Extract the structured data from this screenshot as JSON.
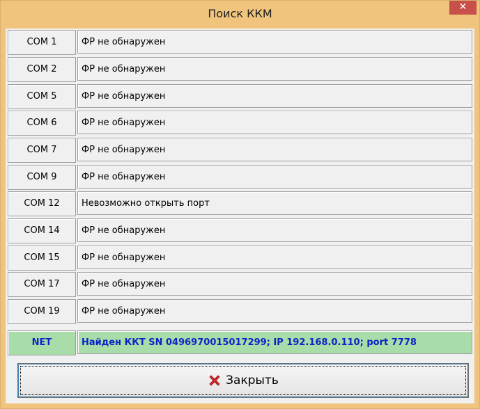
{
  "window": {
    "title": "Поиск ККМ",
    "close_glyph": "✕"
  },
  "rows": [
    {
      "port": "COM 1",
      "status": "ФР не обнаружен"
    },
    {
      "port": "COM 2",
      "status": "ФР не обнаружен"
    },
    {
      "port": "COM 5",
      "status": "ФР не обнаружен"
    },
    {
      "port": "COM 6",
      "status": "ФР не обнаружен"
    },
    {
      "port": "COM 7",
      "status": "ФР не обнаружен"
    },
    {
      "port": "COM 9",
      "status": "ФР не обнаружен"
    },
    {
      "port": "COM 12",
      "status": "Невозможно открыть порт"
    },
    {
      "port": "COM 14",
      "status": "ФР не обнаружен"
    },
    {
      "port": "COM 15",
      "status": "ФР не обнаружен"
    },
    {
      "port": "COM 17",
      "status": "ФР не обнаружен"
    },
    {
      "port": "COM 19",
      "status": "ФР не обнаружен"
    },
    {
      "port": "NET",
      "status": "Найден ККТ SN 0496970015017299; IP 192.168.0.110; port 7778"
    }
  ],
  "close_button": {
    "label": "Закрыть",
    "icon": "red-x-icon"
  },
  "colors": {
    "titlebar": "#f0c47d",
    "close_x": "#c7504a",
    "found_row_bg": "#a8dca8",
    "found_row_text": "#0a24c8",
    "close_icon_red": "#d8262b"
  }
}
